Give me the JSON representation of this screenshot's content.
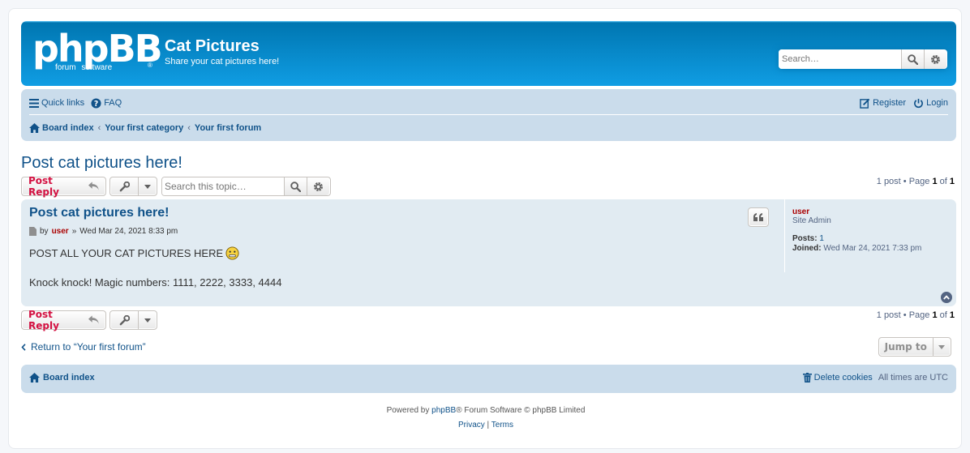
{
  "header": {
    "logo_main": "phpBB",
    "logo_sub1": "forum",
    "logo_sub2": "software",
    "logo_reg": "®",
    "site_title": "Cat Pictures",
    "site_desc": "Share your cat pictures here!",
    "search_placeholder": "Search…",
    "icons": [
      "search-icon",
      "gear-icon"
    ]
  },
  "navbar": {
    "quick_links": "Quick links",
    "faq": "FAQ",
    "register": "Register",
    "login": "Login",
    "breadcrumbs": [
      "Board index",
      "Your first category",
      "Your first forum"
    ]
  },
  "topic": {
    "title": "Post cat pictures here!",
    "post_reply": "Post Reply",
    "search_placeholder": "Search this topic…",
    "pagination": {
      "prefix": "1 post • Page ",
      "current": "1",
      "of": " of ",
      "total": "1"
    }
  },
  "post": {
    "title": "Post cat pictures here!",
    "by": "by",
    "author": "user",
    "date_sep": "»",
    "date": "Wed Mar 24, 2021 8:33 pm",
    "body_line1": "POST ALL YOUR CAT PICTURES HERE",
    "body_line2": "Knock knock! Magic numbers: 1111, 2222, 3333, 4444",
    "profile": {
      "username": "user",
      "rank": "Site Admin",
      "posts_label": "Posts:",
      "posts_value": "1",
      "joined_label": "Joined:",
      "joined_value": "Wed Mar 24, 2021 7:33 pm"
    }
  },
  "bottom": {
    "return_link": "Return to “Your first forum”",
    "jump_to": "Jump to"
  },
  "footer": {
    "board_index": "Board index",
    "delete_cookies": "Delete cookies",
    "timezone": "All times are UTC",
    "powered_prefix": "Powered by ",
    "powered_link": "phpBB",
    "powered_suffix": "® Forum Software © phpBB Limited",
    "privacy": "Privacy",
    "sep": " | ",
    "terms": "Terms"
  },
  "colors": {
    "header_blue": "#12a3eb",
    "navbar_bg": "#cadceb",
    "post_bg": "#e1ebf2",
    "link": "#105289",
    "post_reply_red": "#d31141",
    "author_red": "#aa0000"
  }
}
